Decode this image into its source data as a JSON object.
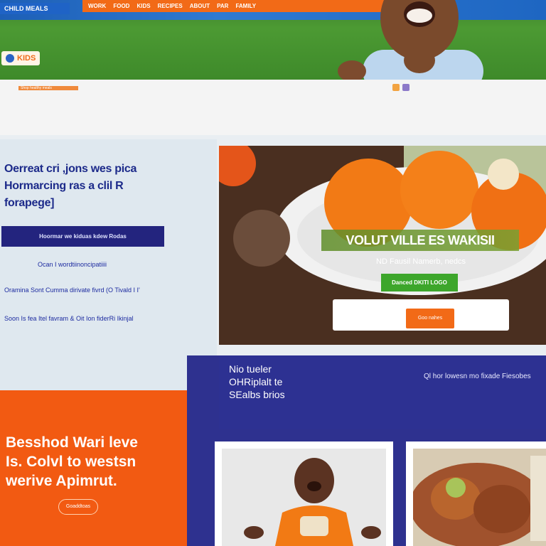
{
  "header": {
    "brand_tag": "CHILD MEALS",
    "nav": [
      "WORK",
      "FOOD",
      "KIDS",
      "RECIPES",
      "ABOUT",
      "PAR",
      "FAMILY"
    ],
    "logo_text": "KIDS"
  },
  "subbar": {
    "ribbon": "Shop healthy meals"
  },
  "promo": {
    "headline": [
      "Oerreat cri  ,jons wes pica",
      "Hormarcing ras a clil R",
      "forapege]"
    ],
    "button_label": "Hoormar we kiduas kdew Rodas",
    "links": [
      "Ocan I wordtiinoncipatiiii",
      "Oramina Sont Cumma dirivate fivrd (O Tivald I I'",
      "Soon Is fea Itel favram & Oit Ion fiderRi Ikinjal"
    ]
  },
  "feature": {
    "overlay_title": "VOLUT VILLE ES WAKISII",
    "subtitle": "ND Fausil Namerb, nedcs",
    "cta_label": "Danced DKITI LOGO",
    "box_button": "Goo nahes"
  },
  "blue": {
    "title": [
      "Nio tueler",
      "OHRiplalt te",
      "SEalbs brios"
    ],
    "note": "Ql hor lowesn mo fixade Fiesobes"
  },
  "orange": {
    "text": [
      "Besshod Wari leve",
      "Is. Colvl to westsn",
      "werive Apimrut."
    ],
    "button_label": "Goaddtoas"
  },
  "colors": {
    "brand_orange": "#f26a17",
    "brand_navy": "#2e318f",
    "cta_green": "#3da62b",
    "link_blue": "#1d2ba0"
  }
}
